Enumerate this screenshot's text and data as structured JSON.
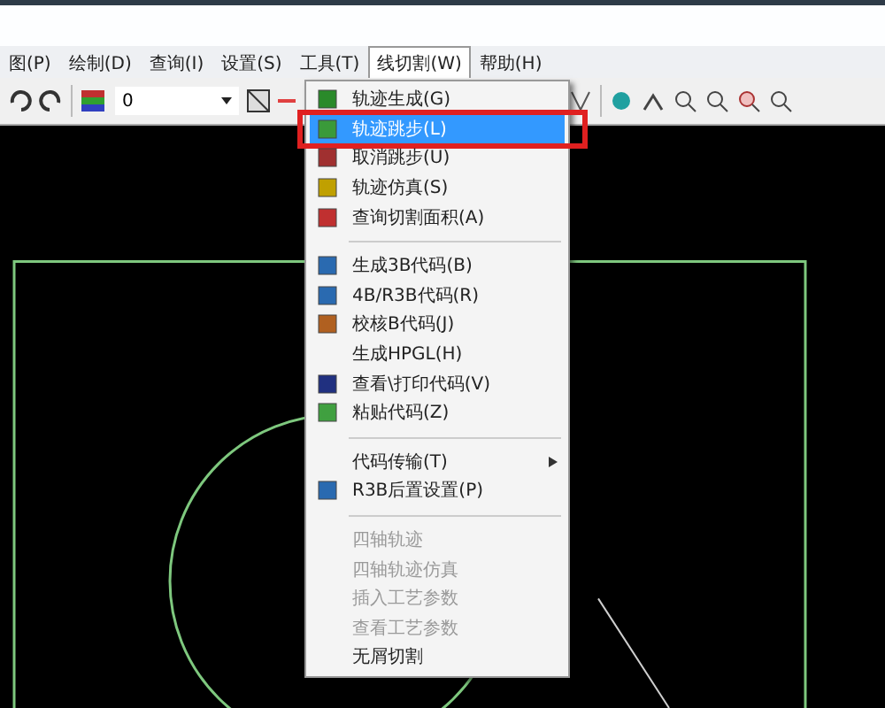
{
  "menubar": [
    {
      "label": "图(P)",
      "selected": false
    },
    {
      "label": "绘制(D)",
      "selected": false
    },
    {
      "label": "查询(I)",
      "selected": false
    },
    {
      "label": "设置(S)",
      "selected": false
    },
    {
      "label": "工具(T)",
      "selected": false
    },
    {
      "label": "线切割(W)",
      "selected": true
    },
    {
      "label": "帮助(H)",
      "selected": false
    }
  ],
  "toolbar": {
    "layer_value": "0"
  },
  "menu": [
    {
      "kind": "item",
      "label": "轨迹生成(G)",
      "disabled": false,
      "selected": false,
      "outlined": false
    },
    {
      "kind": "item",
      "label": "轨迹跳步(L)",
      "disabled": false,
      "selected": true,
      "outlined": true
    },
    {
      "kind": "item",
      "label": "取消跳步(U)",
      "disabled": false,
      "selected": false,
      "outlined": false
    },
    {
      "kind": "item",
      "label": "轨迹仿真(S)",
      "disabled": false,
      "selected": false,
      "outlined": false
    },
    {
      "kind": "item",
      "label": "查询切割面积(A)",
      "disabled": false,
      "selected": false,
      "outlined": false
    },
    {
      "kind": "separator"
    },
    {
      "kind": "item",
      "label": "生成3B代码(B)",
      "disabled": false,
      "selected": false,
      "outlined": false
    },
    {
      "kind": "item",
      "label": "4B/R3B代码(R)",
      "disabled": false,
      "selected": false,
      "outlined": false
    },
    {
      "kind": "item",
      "label": "校核B代码(J)",
      "disabled": false,
      "selected": false,
      "outlined": false
    },
    {
      "kind": "item",
      "label": "生成HPGL(H)",
      "disabled": false,
      "selected": false,
      "outlined": false
    },
    {
      "kind": "item",
      "label": "查看\\打印代码(V)",
      "disabled": false,
      "selected": false,
      "outlined": false
    },
    {
      "kind": "item",
      "label": "粘贴代码(Z)",
      "disabled": false,
      "selected": false,
      "outlined": false
    },
    {
      "kind": "separator"
    },
    {
      "kind": "submenu",
      "label": "代码传输(T)",
      "disabled": false,
      "selected": false,
      "outlined": false
    },
    {
      "kind": "item",
      "label": "R3B后置设置(P)",
      "disabled": false,
      "selected": false,
      "outlined": false
    },
    {
      "kind": "separator"
    },
    {
      "kind": "item",
      "label": "四轴轨迹",
      "disabled": true,
      "selected": false,
      "outlined": false
    },
    {
      "kind": "item",
      "label": "四轴轨迹仿真",
      "disabled": true,
      "selected": false,
      "outlined": false
    },
    {
      "kind": "item",
      "label": "插入工艺参数",
      "disabled": true,
      "selected": false,
      "outlined": false
    },
    {
      "kind": "item",
      "label": "查看工艺参数",
      "disabled": true,
      "selected": false,
      "outlined": false
    },
    {
      "kind": "item",
      "label": "无屑切割",
      "disabled": false,
      "selected": false,
      "outlined": false
    }
  ]
}
